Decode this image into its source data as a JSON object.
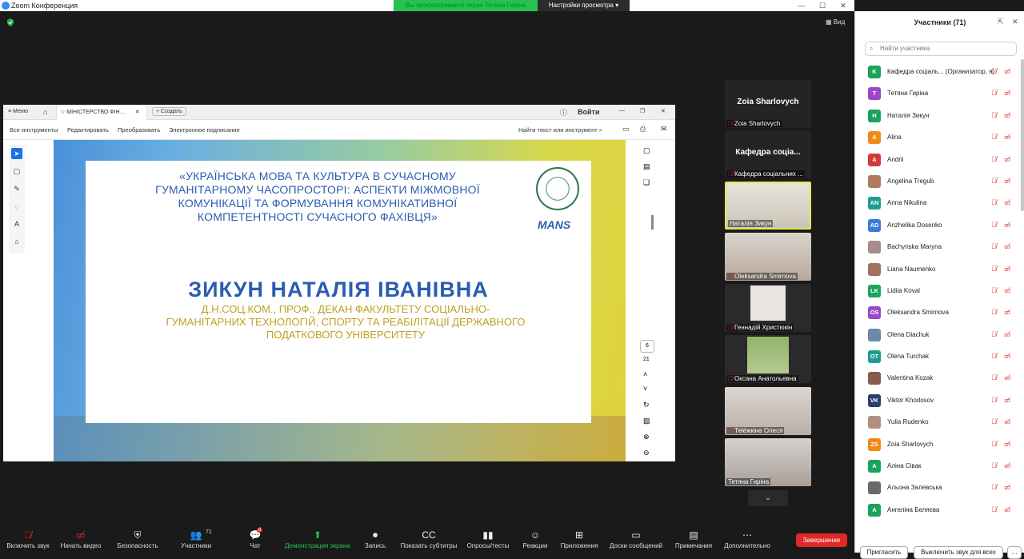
{
  "window": {
    "title": "Zoom Конференция"
  },
  "banner": {
    "sharing_text": "Вы просматриваете экран Тетяна Гиріна",
    "view_settings": "Настройки просмотра"
  },
  "stage": {
    "view_label": "Вид"
  },
  "pdf": {
    "menu": "Меню",
    "tab_title": "МІНІСТЕРСТВО ФІН…",
    "create": "Создать",
    "signin": "Войти",
    "tools": [
      "Все инструменты",
      "Редактировать",
      "Преобразовать",
      "Электронное подписание"
    ],
    "search": "Найти текст или инструмент",
    "page_current": "6",
    "page_total": "21"
  },
  "slide": {
    "subtitle": "«УКРАЇНСЬКА МОВА ТА КУЛЬТУРА В СУЧАСНОМУ ГУМАНІТАРНОМУ ЧАСОПРОСТОРІ: АСПЕКТИ МІЖМОВНОЇ КОМУНІКАЦІЇ ТА ФОРМУВАННЯ КОМУНІКАТИВНОЇ КОМПЕТЕНТНОСТІ СУЧАСНОГО ФАХІВЦЯ»",
    "name": "ЗИКУН НАТАЛІЯ ІВАНІВНА",
    "role": "Д.Н.СОЦ.КОМ., ПРОФ., ДЕКАН ФАКУЛЬТЕТУ СОЦІАЛЬНО-ГУМАНІТАРНИХ ТЕХНОЛОГІЙ, СПОРТУ ТА РЕАБІЛІТАЦІЇ ДЕРЖАВНОГО ПОДАТКОВОГО УНІВЕРСИТЕТУ",
    "logo_text": "MANS"
  },
  "videos": [
    {
      "title": "Zoia Sharlovych",
      "name": "Zoia Sharlovych",
      "muted": true
    },
    {
      "title": "Кафедра соціа...",
      "name": "Кафедра соціальних ...",
      "muted": true
    },
    {
      "name": "Наталія Зикун",
      "muted": false
    },
    {
      "name": "Oleksandra Smirnova",
      "muted": true
    },
    {
      "name": "Геннадій Христюкін",
      "muted": true
    },
    {
      "name": "Оксана Анатольевна",
      "muted": true
    },
    {
      "name": "Теléжкіна Олеся",
      "muted": true
    },
    {
      "name": "Тетяна Гиріна",
      "muted": false
    }
  ],
  "panel": {
    "title": "Участники (71)",
    "search_placeholder": "Найти участника",
    "invite": "Пригласить",
    "mute_all": "Выключить звук для всех",
    "participants": [
      {
        "initials": "K",
        "name": "Кафедра соціаль... (Организатор, я)",
        "color": "#1aa35a"
      },
      {
        "initials": "T",
        "name": "Тетяна Гиріна",
        "color": "#9b47c8"
      },
      {
        "initials": "H",
        "name": "Наталія Зикун",
        "color": "#1aa35a"
      },
      {
        "initials": "A",
        "name": "Alina",
        "color": "#f08a17"
      },
      {
        "initials": "A",
        "name": "Andrii",
        "color": "#d23b3b"
      },
      {
        "initials": "",
        "name": "Angelina Tregub",
        "color": "#b07a60"
      },
      {
        "initials": "AN",
        "name": "Anna Nikulina",
        "color": "#1f9c8f"
      },
      {
        "initials": "AD",
        "name": "Anzhelika Dosenko",
        "color": "#3a7bd5"
      },
      {
        "initials": "",
        "name": "Bachynska Maryna",
        "color": "#a88a8a"
      },
      {
        "initials": "",
        "name": "Liana Naumenko",
        "color": "#a07060"
      },
      {
        "initials": "LK",
        "name": "Lidiia Koval",
        "color": "#1aa35a"
      },
      {
        "initials": "OS",
        "name": "Oleksandra Smirnova",
        "color": "#9b47c8"
      },
      {
        "initials": "",
        "name": "Olena Diachuk",
        "color": "#6a8aa8"
      },
      {
        "initials": "OT",
        "name": "Olena Turchak",
        "color": "#1f9c8f"
      },
      {
        "initials": "",
        "name": "Valentina Kozak",
        "color": "#8a5a4a"
      },
      {
        "initials": "VK",
        "name": "Viktor Khodosov",
        "color": "#2a3f6a"
      },
      {
        "initials": "",
        "name": "Yulia Rudenko",
        "color": "#b09080"
      },
      {
        "initials": "ZS",
        "name": "Zoia Sharlovych",
        "color": "#f08a17"
      },
      {
        "initials": "A",
        "name": "Аліна Сівак",
        "color": "#1aa35a"
      },
      {
        "initials": "",
        "name": "Альона Залевська",
        "color": "#6a6a6a"
      },
      {
        "initials": "A",
        "name": "Ангеліна Беляєва",
        "color": "#1aa35a"
      }
    ]
  },
  "toolbar": {
    "items": [
      "Включить звук",
      "Начать видео",
      "Безопасность",
      "Участники",
      "Чат",
      "Демонстрация экрана",
      "Запись",
      "Показать субтитры",
      "Опросы/тесты",
      "Реакции",
      "Приложения",
      "Доски сообщений",
      "Примечания",
      "Дополнительно"
    ],
    "participants_count": "71",
    "chat_badge": "8",
    "end": "Завершение"
  }
}
